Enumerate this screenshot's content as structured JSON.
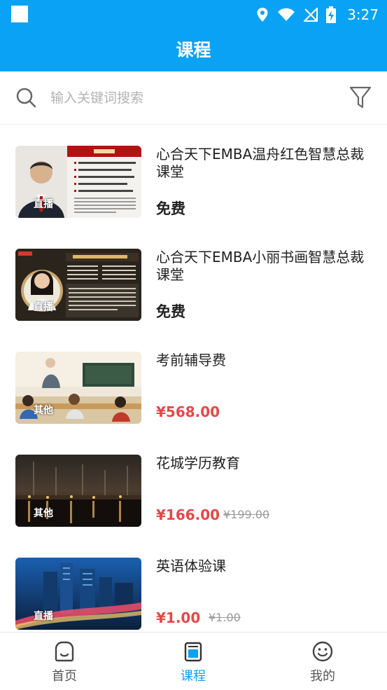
{
  "status_bar": {
    "time": "3:27"
  },
  "header": {
    "title": "课程"
  },
  "search": {
    "placeholder": "输入关键词搜索"
  },
  "courses": [
    {
      "title": "心合天下EMBA温舟红色智慧总裁课堂",
      "badge": "直播",
      "price": "免费",
      "original_price": ""
    },
    {
      "title": "心合天下EMBA小丽书画智慧总裁课堂",
      "badge": "直播",
      "price": "免费",
      "original_price": ""
    },
    {
      "title": "考前辅导费",
      "badge": "其他",
      "price": "¥568.00",
      "original_price": ""
    },
    {
      "title": "花城学历教育",
      "badge": "其他",
      "price": "¥166.00",
      "original_price": "¥199.00"
    },
    {
      "title": "英语体验课",
      "badge": "直播",
      "price": "¥1.00",
      "original_price": "¥1.00"
    }
  ],
  "tabs": [
    {
      "label": "首页",
      "icon": "home-icon",
      "active": false
    },
    {
      "label": "课程",
      "icon": "course-icon",
      "active": true
    },
    {
      "label": "我的",
      "icon": "smiley-icon",
      "active": false
    }
  ],
  "colors": {
    "primary": "#0aa2f5",
    "price_red": "#e84747"
  }
}
